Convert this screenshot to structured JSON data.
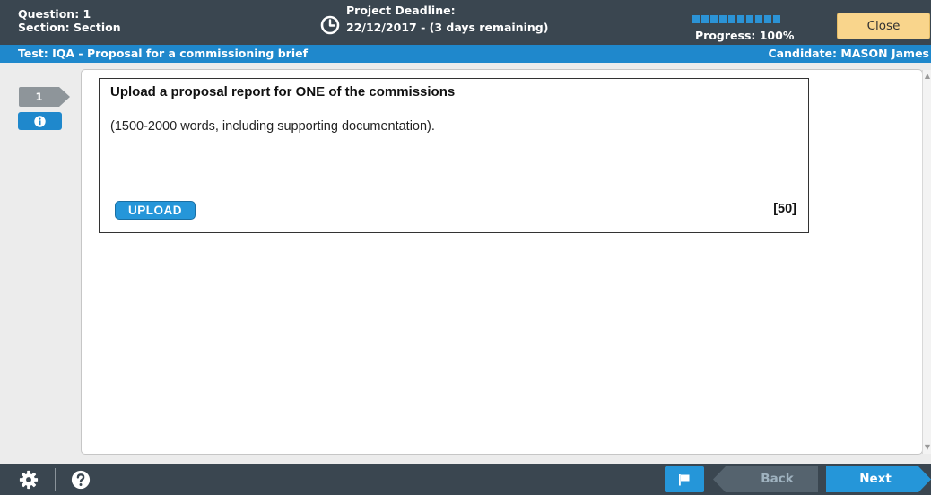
{
  "header": {
    "question_label": "Question: 1",
    "section_label": "Section: Section",
    "deadline_label": "Project Deadline:",
    "deadline_date": "22/12/2017 - (3 days remaining)",
    "progress_label": "Progress: 100%",
    "progress_fraction": 1.0,
    "close_label": "Close",
    "colors": {
      "bar": "#3a4650",
      "accent": "#1f88cc",
      "close": "#f9d58c"
    }
  },
  "subheader": {
    "test_name": "Test: IQA - Proposal for a commissioning brief",
    "candidate": "Candidate: MASON James"
  },
  "nav": {
    "question_number": "1",
    "info_icon": "info-icon"
  },
  "question": {
    "title": "Upload a proposal report for ONE of the commissions",
    "body": "(1500-2000 words, including supporting documentation).",
    "upload_label": "UPLOAD",
    "marks": "[50]"
  },
  "footer": {
    "settings_icon": "gear-icon",
    "help_icon": "help-icon",
    "flag_icon": "flag-icon",
    "back_label": "Back",
    "next_label": "Next"
  }
}
